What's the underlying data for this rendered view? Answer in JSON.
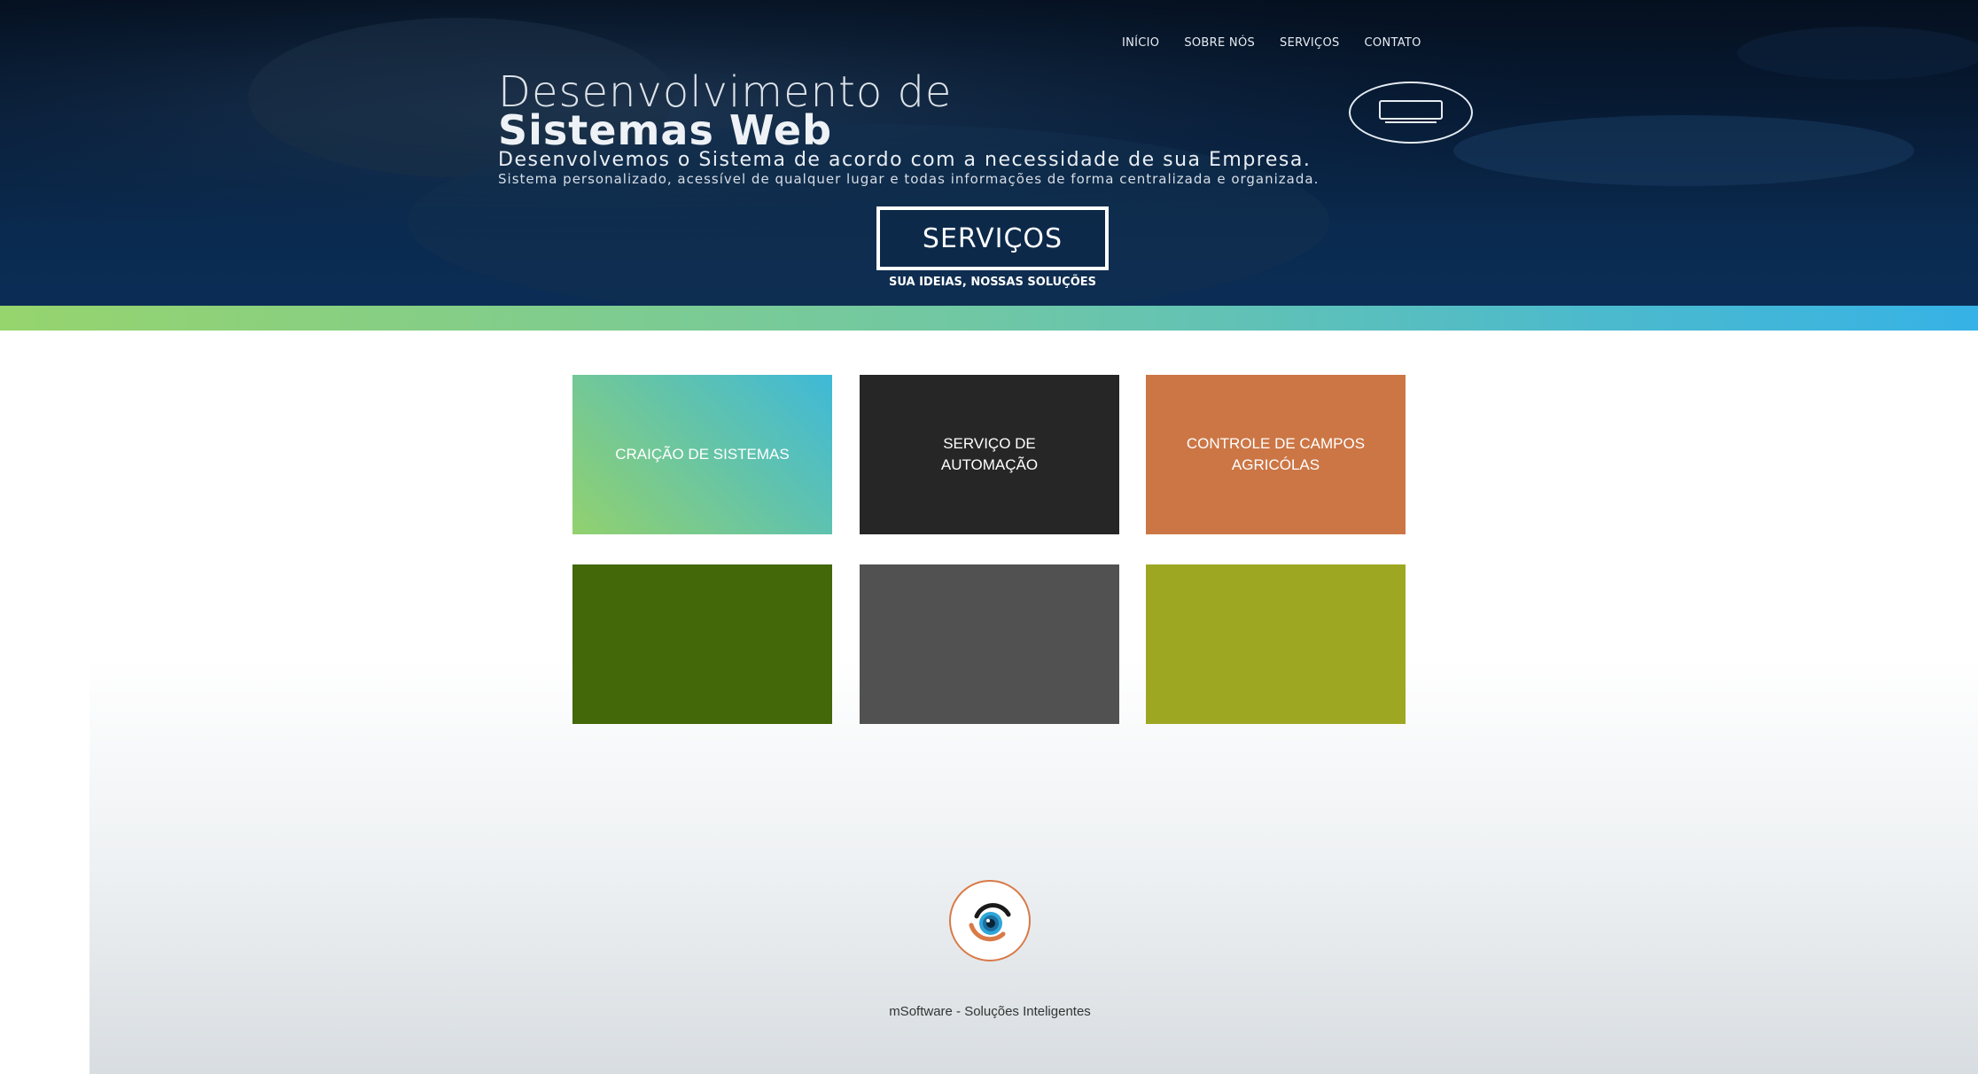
{
  "nav": {
    "items": [
      {
        "label": "INÍCIO"
      },
      {
        "label": "SOBRE NÓS"
      },
      {
        "label": "SERVIÇOS"
      },
      {
        "label": "CONTATO"
      }
    ]
  },
  "hero": {
    "title_line1": "Desenvolvimento de",
    "title_line2": "Sistemas Web",
    "subtitle": "Desenvolvemos o Sistema de acordo com a necessidade de sua Empresa.",
    "description": "Sistema personalizado, acessível de qualquer lugar e todas informações de forma centralizada e organizada.",
    "badge_icon": "monitor-icon",
    "cta_label": "SERVIÇOS",
    "tagline": "SUA IDEIAS, NOSSAS SOLUÇÕES"
  },
  "band_colors": [
    "#96d46d",
    "#36b2e6"
  ],
  "services": [
    {
      "label": "CRAIÇÃO DE SISTEMAS",
      "color": "#92d16e"
    },
    {
      "label": "SERVIÇO DE AUTOMAÇÃO",
      "color": "#262626"
    },
    {
      "label": "CONTROLE DE CAMPOS AGRICÓLAS",
      "color": "#cc7645"
    },
    {
      "label": "",
      "color": "#426809"
    },
    {
      "label": "",
      "color": "#525152"
    },
    {
      "label": "",
      "color": "#9ea722"
    }
  ],
  "footer": {
    "logo_icon": "eye-logo-icon",
    "text": "mSoftware - Soluções Inteligentes"
  }
}
